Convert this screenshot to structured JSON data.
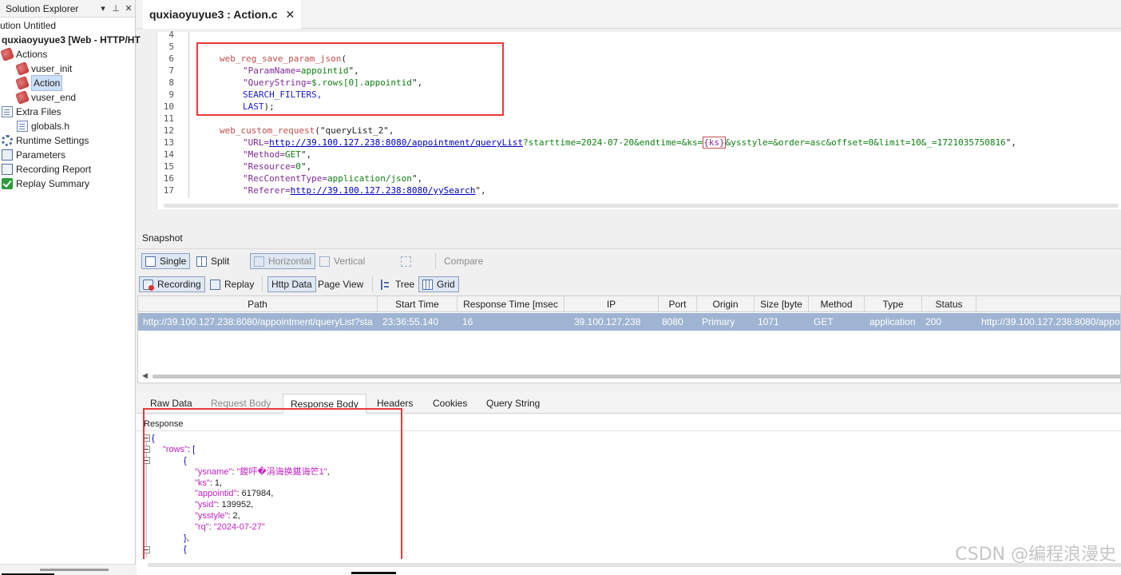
{
  "solution_explorer": {
    "title": "Solution Explorer",
    "items": [
      {
        "label": "ution Untitled"
      },
      {
        "label": "quxiaoyuyue3 [Web - HTTP/HT"
      },
      {
        "label": "Actions"
      },
      {
        "label": "vuser_init"
      },
      {
        "label": "Action"
      },
      {
        "label": "vuser_end"
      },
      {
        "label": "Extra Files"
      },
      {
        "label": "globals.h"
      },
      {
        "label": "Runtime Settings"
      },
      {
        "label": "Parameters"
      },
      {
        "label": "Recording Report"
      },
      {
        "label": "Replay Summary"
      }
    ]
  },
  "editor": {
    "tab_title": "quxiaoyuyue3 : Action.c",
    "line_numbers": [
      "4",
      "5",
      "6",
      "7",
      "8",
      "9",
      "10",
      "11",
      "12",
      "13",
      "14",
      "15",
      "16",
      "17"
    ],
    "code": {
      "l6_fn": "web_reg_save_param_json",
      "l6_rest": "(",
      "l7_a": "\"ParamName=",
      "l7_b": "appointid",
      "l7_c": "\",",
      "l8_a": "\"QueryString=",
      "l8_b": "$.rows[0].appointid",
      "l8_c": "\",",
      "l9": "SEARCH_FILTERS,",
      "l10": "LAST",
      "l10_end": ");",
      "l12_fn": "web_custom_request",
      "l12_rest": "(\"queryList_2\",",
      "l13_a": "\"URL=",
      "l13_url": "http://39.100.127.238:8080/appointment/queryList",
      "l13_b": "?starttime=2024-07-20&endtime=&ks=",
      "l13_param": "{ks}",
      "l13_c": "&ysstyle=&order=asc&offset=0&limit=10&_=1721035750816",
      "l13_d": "\",",
      "l14_a": "\"Method=",
      "l14_b": "GET",
      "l14_c": "\",",
      "l15_a": "\"Resource=",
      "l15_b": "0",
      "l15_c": "\",",
      "l16_a": "\"RecContentType=",
      "l16_b": "application/json",
      "l16_c": "\",",
      "l17_a": "\"Referer=",
      "l17_url": "http://39.100.127.238:8080/yySearch",
      "l17_c": "\","
    }
  },
  "snapshot": {
    "label": "Snapshot",
    "toolbar1": {
      "single": "Single",
      "split": "Split",
      "horizontal": "Horizontal",
      "vertical": "Vertical",
      "compare": "Compare"
    },
    "toolbar2": {
      "recording": "Recording",
      "replay": "Replay",
      "http_data": "Http Data",
      "page_view": "Page View",
      "tree": "Tree",
      "grid": "Grid"
    },
    "columns": [
      "Path",
      "Start Time",
      "Response Time [msec",
      "IP",
      "Port",
      "Origin",
      "Size [byte",
      "Method",
      "Type",
      "Status"
    ],
    "row": {
      "path": "http://39.100.127.238:8080/appointment/queryList?sta",
      "start_time": "23:36:55.140",
      "response_time": "16",
      "ip": "39.100.127.238",
      "port": "8080",
      "origin": "Primary",
      "size": "1071",
      "method": "GET",
      "type": "application",
      "status": "200",
      "extra": "http://39.100.127.238:8080/appoi"
    }
  },
  "response": {
    "tabs": [
      "Raw Data",
      "Request Body",
      "Response Body",
      "Headers",
      "Cookies",
      "Query String"
    ],
    "active_tab": "Response Body",
    "label": "Response",
    "json_lines": {
      "l1": "{",
      "rows_key": "\"rows\"",
      "rows_colon": ": [",
      "l3": "{",
      "ysname_key": "\"ysname\"",
      "ysname_val": "\"鍐呯�涓诲换鍖诲笀1\"",
      "ks_key": "\"ks\"",
      "ks_val": ": 1,",
      "appointid_key": "\"appointid\"",
      "appointid_val": ": 617984,",
      "ysid_key": "\"ysid\"",
      "ysid_val": ": 139952,",
      "ysstyle_key": "\"ysstyle\"",
      "ysstyle_val": ": 2,",
      "rq_key": "\"rq\"",
      "rq_val": "\"2024-07-27\"",
      "close": "},",
      "open2": "{"
    }
  },
  "watermark": "CSDN @编程浪漫史",
  "colors": {
    "highlight_box": "#e83a3a",
    "selected_row": "#9fb4d2",
    "function": "#c0504d",
    "json_key": "#c020c0"
  }
}
